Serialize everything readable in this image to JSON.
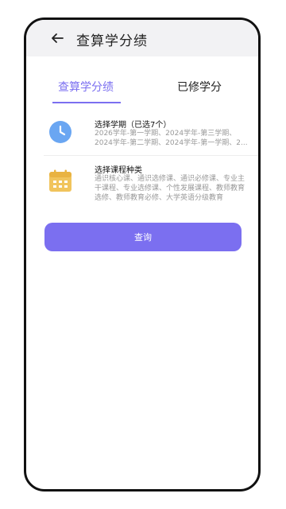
{
  "header": {
    "title": "查算学分绩",
    "back_icon": "arrow-left-icon"
  },
  "tabs": [
    {
      "label": "查算学分绩",
      "active": true
    },
    {
      "label": "已修学分",
      "active": false
    }
  ],
  "colors": {
    "accent": "#7b6ff0",
    "clock_icon": "#6aa6f2",
    "calendar_icon": "#f1c45c"
  },
  "rows": {
    "term": {
      "icon": "clock-icon",
      "title": "选择学期（已选7个）",
      "sub_lines": [
        "2026学年-第一学期、2024学年-第三学期、",
        "2024学年-第二学期、2024学年-第一学期、2..."
      ]
    },
    "course_type": {
      "icon": "calendar-icon",
      "title": "选择课程种类",
      "sub_lines": [
        "通识核心课、通识选修课、通识必修课、专业主",
        "干课程、专业选修课、个性发展课程、教师教育",
        "选修、教师教育必修、大学英语分级教育"
      ]
    }
  },
  "query_button": {
    "label": "查询"
  }
}
